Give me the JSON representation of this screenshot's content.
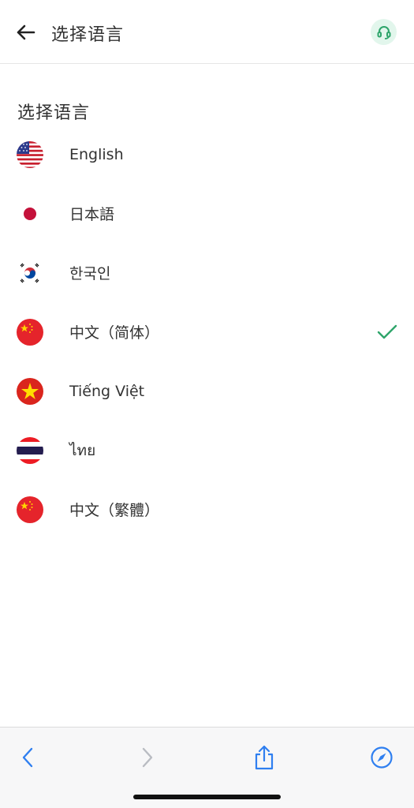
{
  "header": {
    "title": "选择语言",
    "back_icon": "arrow-left-icon",
    "support_icon": "headset-icon"
  },
  "section": {
    "title": "选择语言"
  },
  "languages": [
    {
      "label": "English",
      "flag": "us-flag-icon",
      "selected": false
    },
    {
      "label": "日本語",
      "flag": "japan-flag-icon",
      "selected": false
    },
    {
      "label": "한국인",
      "flag": "korea-flag-icon",
      "selected": false
    },
    {
      "label": "中文（简体）",
      "flag": "china-flag-icon",
      "selected": true
    },
    {
      "label": "Tiếng Việt",
      "flag": "vietnam-flag-icon",
      "selected": false
    },
    {
      "label": "ไทย",
      "flag": "thailand-flag-icon",
      "selected": false
    },
    {
      "label": "中文（繁體）",
      "flag": "china-flag-icon",
      "selected": false
    }
  ],
  "browser_toolbar": {
    "back_icon": "chevron-left-icon",
    "forward_icon": "chevron-right-icon",
    "share_icon": "share-icon",
    "compass_icon": "compass-icon"
  },
  "colors": {
    "accent_green": "#2fa56b",
    "support_bg": "#e2f6ec",
    "browser_blue": "#2f7ff0",
    "browser_disabled": "#b9bcc2"
  }
}
